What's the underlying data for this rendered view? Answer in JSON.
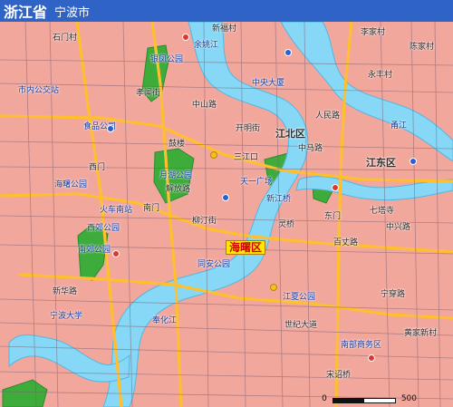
{
  "header": {
    "province": "浙江省",
    "city": "宁波市"
  },
  "district_label": "海曙区",
  "scale": {
    "start": "0",
    "end": "500"
  },
  "labels": {
    "xinfu": "新福村",
    "lijiacun": "李家村",
    "shimen": "石门村",
    "chenjiacun": "陈家村",
    "yinzhou_park": "银凤公园",
    "cbd": "中央大厦",
    "yongfeng": "永丰村",
    "shinei": "市内公交站",
    "zhongshan": "中山路",
    "renmin": "人民路",
    "shipin": "食品公司",
    "kaiming": "开明街",
    "gulou": "鼓楼",
    "yuehu": "月湖公园",
    "sanjiang": "三江口",
    "jiangbei": "江北区",
    "jiangdong": "江东区",
    "tianyi": "天一广场",
    "zhongma": "中马路",
    "nanmen": "南门",
    "xigong": "西门",
    "dongmen": "东门",
    "xin_jiang": "新江桥",
    "yong_jiang": "甬江",
    "yuyao_jiang": "余姚江",
    "fenghua_jiang": "奉化江",
    "haishu_park": "海曙公园",
    "west_park": "西郊公园",
    "nanjiao": "南郊公园",
    "xiaowei": "孝闻街",
    "dazhan": "火车南站",
    "liuting": "柳汀街",
    "lingqiao": "灵桥",
    "tongan": "同安公园",
    "baizhang": "百丈路",
    "zhongxing": "中兴路",
    "jiefang": "解放路",
    "xinhua": "新华路",
    "ningbo_uni": "宁波大学",
    "ningchuan": "宁穿路",
    "shibei": "世纪大道",
    "jiangxia": "江夏公园",
    "qilongqiao": "七塔寺",
    "nanbu": "南部商务区",
    "huangjia": "黄家新村",
    "songchu": "宋诏桥"
  }
}
